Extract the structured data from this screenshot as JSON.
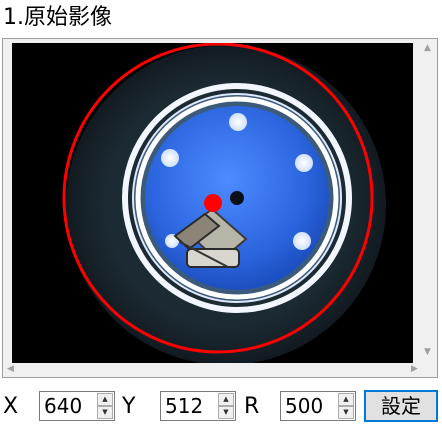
{
  "window": {
    "section_title": "1.原始影像"
  },
  "image_view": {
    "image_description_icon": "camera-image",
    "overlay_color": "#ff0000",
    "marker_color": "#ff0000"
  },
  "controls": {
    "x_label": "X",
    "x_value": "640",
    "y_label": "Y",
    "y_value": "512",
    "r_label": "R",
    "r_value": "500",
    "set_button_label": "設定"
  },
  "colors": {
    "accent": "#0078d7",
    "image_bg": "#000000",
    "lens_blue": "#2f6fe0"
  }
}
